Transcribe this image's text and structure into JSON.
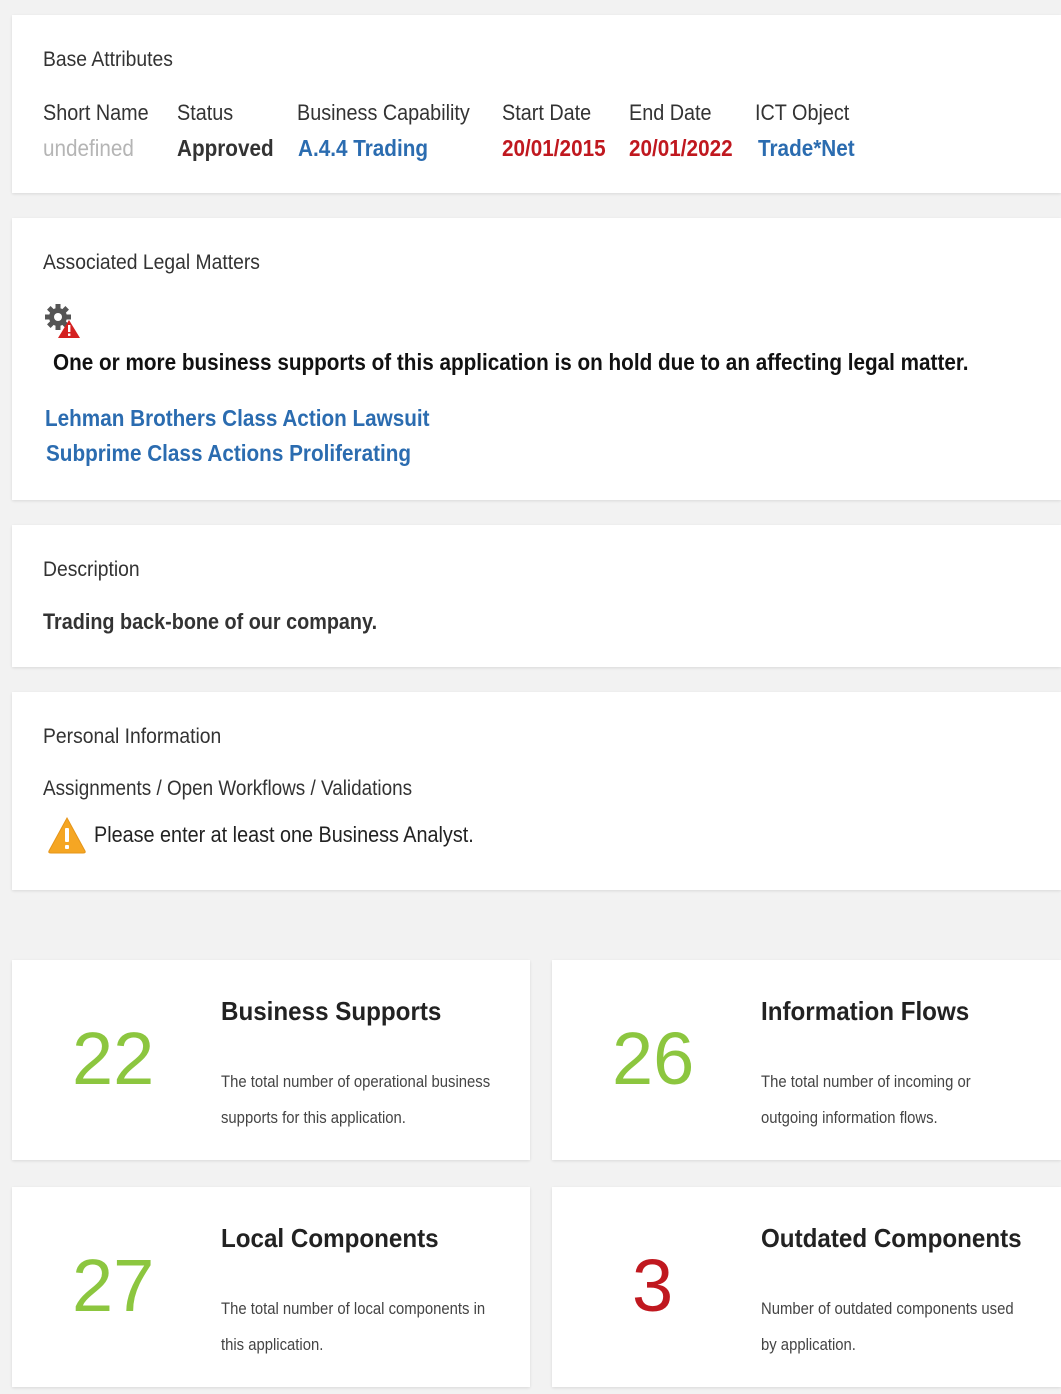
{
  "base_attributes": {
    "title": "Base Attributes",
    "fields": [
      {
        "label": "Short Name",
        "value": "undefined"
      },
      {
        "label": "Status",
        "value": "Approved"
      },
      {
        "label": "Business Capability",
        "value": "A.4.4 Trading"
      },
      {
        "label": "Start Date",
        "value": "20/01/2015"
      },
      {
        "label": "End Date",
        "value": "20/01/2022"
      },
      {
        "label": "ICT Object",
        "value": "Trade*Net"
      }
    ]
  },
  "legal": {
    "title": "Associated Legal Matters",
    "icon": "gear-warning-icon",
    "notice": "One or more business supports of this application is on hold due to an affecting legal matter.",
    "links": [
      "Lehman Brothers Class Action Lawsuit",
      "Subprime Class Actions Proliferating"
    ]
  },
  "description": {
    "title": "Description",
    "text": "Trading back-bone of our company."
  },
  "personal": {
    "title": "Personal Information",
    "subtitle": "Assignments / Open Workflows / Validations",
    "warning_icon": "warning-triangle-icon",
    "warning": "Please enter at least one Business Analyst."
  },
  "stats": [
    {
      "value": "22",
      "title": "Business Supports",
      "desc": "The total number of operational business supports for this application.",
      "color": "#8cc63f"
    },
    {
      "value": "26",
      "title": "Information Flows",
      "desc": "The total number of incoming or outgoing information flows.",
      "color": "#8cc63f"
    },
    {
      "value": "27",
      "title": "Local Components",
      "desc": "The total number of local components in this application.",
      "color": "#8cc63f"
    },
    {
      "value": "3",
      "title": "Outdated Components",
      "desc": "Number of outdated components used by application.",
      "color": "#c0181f"
    }
  ],
  "colors": {
    "link": "#2b6cb0",
    "date": "#c0181f",
    "muted": "#b5b5b5"
  }
}
